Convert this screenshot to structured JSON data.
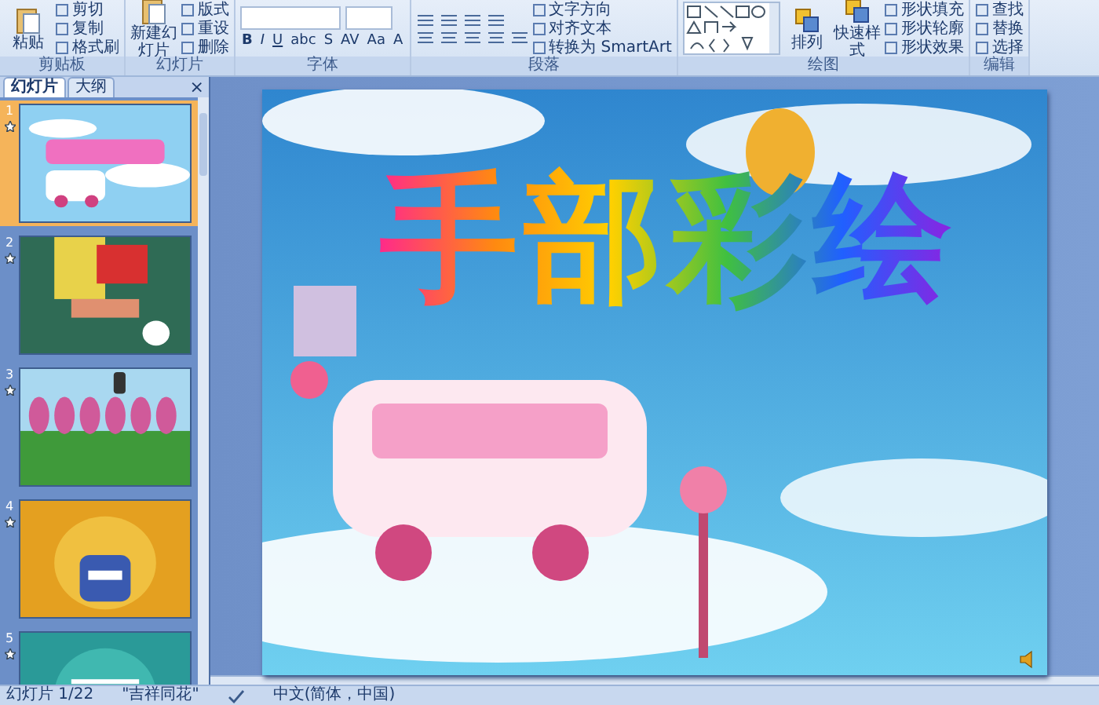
{
  "ribbon": {
    "groups": [
      {
        "kind": "buttons",
        "label": "剪贴板",
        "large": [
          "粘贴"
        ],
        "small": [
          "剪切",
          "复制",
          "格式刷"
        ]
      },
      {
        "kind": "buttons",
        "label": "幻灯片",
        "large": [
          "新建幻灯片"
        ],
        "small": [
          "版式",
          "重设",
          "删除"
        ]
      },
      {
        "kind": "font",
        "label": "字体",
        "buttons": [
          "B",
          "I",
          "U",
          "abc",
          "S",
          "AV",
          "Aa",
          "A"
        ]
      },
      {
        "kind": "paragraph",
        "label": "段落",
        "small": [
          "文字方向",
          "对齐文本",
          "转换为 SmartArt"
        ]
      },
      {
        "kind": "drawing",
        "label": "绘图",
        "large": [
          "排列",
          "快速样式"
        ],
        "small": [
          "形状填充",
          "形状轮廓",
          "形状效果"
        ]
      },
      {
        "kind": "buttons",
        "label": "编辑",
        "small": [
          "查找",
          "替换",
          "选择"
        ]
      }
    ]
  },
  "pane": {
    "tabs": [
      {
        "label": "幻灯片",
        "selected": true
      },
      {
        "label": "大纲",
        "selected": false
      }
    ],
    "close": "×",
    "slides": [
      {
        "number": "1",
        "selected": true
      },
      {
        "number": "2",
        "selected": false
      },
      {
        "number": "3",
        "selected": false
      },
      {
        "number": "4",
        "selected": false
      },
      {
        "number": "5",
        "selected": false
      }
    ]
  },
  "slide": {
    "title": "手部彩绘"
  },
  "status_bar": {
    "slide": "幻灯片 1/22",
    "theme": "\"吉祥同花\"",
    "language": "中文(简体，中国)"
  }
}
